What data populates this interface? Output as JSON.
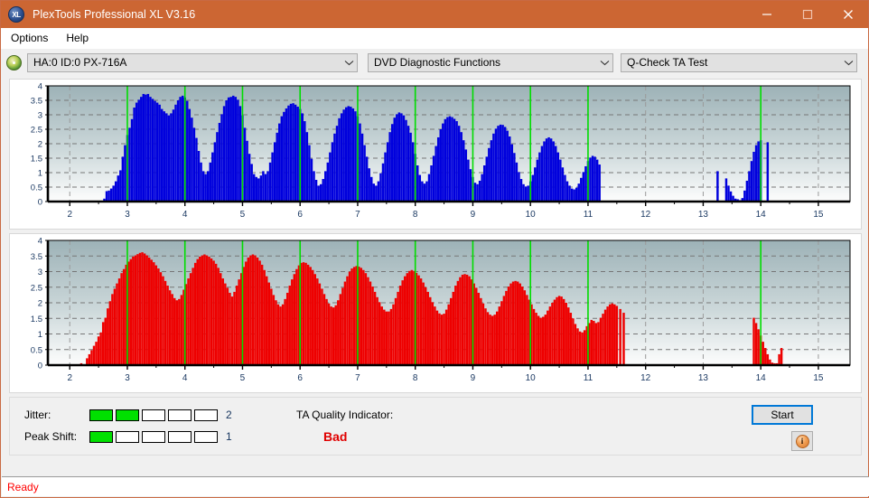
{
  "window": {
    "title": "PlexTools Professional XL V3.16",
    "app_icon": "XL",
    "minimize_label": "Minimize",
    "maximize_label": "Maximize",
    "close_label": "Close"
  },
  "menu": {
    "items": [
      {
        "label": "Options"
      },
      {
        "label": "Help"
      }
    ]
  },
  "toolbar": {
    "drive_icon": "disc-icon",
    "drive_select": "HA:0 ID:0  PX-716A",
    "function_select": "DVD Diagnostic Functions",
    "test_select": "Q-Check TA Test"
  },
  "indicators": {
    "jitter_label": "Jitter:",
    "jitter_value": "2",
    "jitter_filled": 2,
    "jitter_total": 5,
    "peak_shift_label": "Peak Shift:",
    "peak_shift_value": "1",
    "peak_shift_filled": 1,
    "peak_shift_total": 5,
    "meter_on_color": "#00e000",
    "ta_label": "TA Quality Indicator:",
    "ta_value": "Bad",
    "ta_color": "#e00000"
  },
  "actions": {
    "start_label": "Start",
    "info_label": "i",
    "info_icon": "info-icon"
  },
  "status": {
    "text": "Ready",
    "color": "#ff0000"
  },
  "chart_data": [
    {
      "type": "bar",
      "name": "jitter-chart",
      "title": "",
      "xlabel": "",
      "ylabel": "",
      "color": "#0000dd",
      "xlim": [
        1.62,
        15.55
      ],
      "ylim": [
        0,
        4
      ],
      "yticks": [
        0,
        0.5,
        1,
        1.5,
        2,
        2.5,
        3,
        3.5,
        4
      ],
      "ytick_labels": [
        "0",
        "0.5",
        "1",
        "1.5",
        "2",
        "2.5",
        "3",
        "3.5",
        "4"
      ],
      "xticks": [
        2,
        3,
        4,
        5,
        6,
        7,
        8,
        9,
        10,
        11,
        12,
        13,
        14,
        15
      ],
      "xtick_labels": [
        "2",
        "3",
        "4",
        "5",
        "6",
        "7",
        "8",
        "9",
        "10",
        "11",
        "12",
        "13",
        "14",
        "15"
      ],
      "grid": true,
      "marker_color": "#00dd00",
      "markers": [
        3,
        4,
        5,
        6,
        7,
        8,
        9,
        10,
        11,
        14
      ],
      "bar_width": 0.0385,
      "x": [
        2.6,
        2.64,
        2.68,
        2.72,
        2.76,
        2.8,
        2.84,
        2.88,
        2.92,
        2.96,
        3.0,
        3.04,
        3.08,
        3.12,
        3.16,
        3.2,
        3.24,
        3.28,
        3.32,
        3.36,
        3.4,
        3.44,
        3.48,
        3.52,
        3.56,
        3.6,
        3.64,
        3.68,
        3.72,
        3.76,
        3.8,
        3.84,
        3.88,
        3.92,
        3.96,
        4.0,
        4.04,
        4.08,
        4.12,
        4.16,
        4.2,
        4.24,
        4.28,
        4.32,
        4.36,
        4.4,
        4.44,
        4.48,
        4.52,
        4.56,
        4.6,
        4.64,
        4.68,
        4.72,
        4.76,
        4.8,
        4.84,
        4.88,
        4.92,
        4.96,
        5.0,
        5.04,
        5.08,
        5.12,
        5.16,
        5.2,
        5.24,
        5.28,
        5.32,
        5.36,
        5.4,
        5.44,
        5.48,
        5.52,
        5.56,
        5.6,
        5.64,
        5.68,
        5.72,
        5.76,
        5.8,
        5.84,
        5.88,
        5.92,
        5.96,
        6.0,
        6.04,
        6.08,
        6.12,
        6.16,
        6.2,
        6.24,
        6.28,
        6.32,
        6.36,
        6.4,
        6.44,
        6.48,
        6.52,
        6.56,
        6.6,
        6.64,
        6.68,
        6.72,
        6.76,
        6.8,
        6.84,
        6.88,
        6.92,
        6.96,
        7.0,
        7.04,
        7.08,
        7.12,
        7.16,
        7.2,
        7.24,
        7.28,
        7.32,
        7.36,
        7.4,
        7.44,
        7.48,
        7.52,
        7.56,
        7.6,
        7.64,
        7.68,
        7.72,
        7.76,
        7.8,
        7.84,
        7.88,
        7.92,
        7.96,
        8.0,
        8.04,
        8.08,
        8.12,
        8.16,
        8.2,
        8.24,
        8.28,
        8.32,
        8.36,
        8.4,
        8.44,
        8.48,
        8.52,
        8.56,
        8.6,
        8.64,
        8.68,
        8.72,
        8.76,
        8.8,
        8.84,
        8.88,
        8.92,
        8.96,
        9.0,
        9.04,
        9.08,
        9.12,
        9.16,
        9.2,
        9.24,
        9.28,
        9.32,
        9.36,
        9.4,
        9.44,
        9.48,
        9.52,
        9.56,
        9.6,
        9.64,
        9.68,
        9.72,
        9.76,
        9.8,
        9.84,
        9.88,
        9.92,
        9.96,
        10.0,
        10.04,
        10.08,
        10.12,
        10.16,
        10.2,
        10.24,
        10.28,
        10.32,
        10.36,
        10.4,
        10.44,
        10.48,
        10.52,
        10.56,
        10.6,
        10.64,
        10.68,
        10.72,
        10.76,
        10.8,
        10.84,
        10.88,
        10.92,
        10.96,
        11.0,
        11.04,
        11.08,
        11.12,
        11.16,
        11.2,
        13.25,
        13.4,
        13.44,
        13.48,
        13.52,
        13.56,
        13.6,
        13.64,
        13.68,
        13.72,
        13.76,
        13.8,
        13.84,
        13.88,
        13.92,
        13.96,
        14.0,
        14.12
      ],
      "values": [
        0.1,
        0.36,
        0.38,
        0.45,
        0.55,
        0.7,
        0.9,
        1.08,
        1.55,
        1.95,
        2.3,
        2.55,
        2.85,
        3.25,
        3.42,
        3.52,
        3.62,
        3.72,
        3.7,
        3.72,
        3.62,
        3.55,
        3.48,
        3.42,
        3.35,
        3.2,
        3.12,
        3.05,
        2.98,
        3.05,
        3.18,
        3.35,
        3.5,
        3.62,
        3.66,
        3.6,
        3.48,
        3.2,
        2.9,
        2.55,
        2.2,
        1.75,
        1.35,
        1.05,
        0.95,
        1.05,
        1.35,
        1.7,
        2.05,
        2.4,
        2.72,
        3.02,
        3.3,
        3.5,
        3.6,
        3.62,
        3.66,
        3.62,
        3.52,
        3.3,
        2.98,
        2.55,
        2.1,
        1.65,
        1.3,
        0.95,
        0.85,
        0.8,
        0.9,
        1.05,
        0.95,
        1.05,
        1.35,
        1.7,
        2.05,
        2.38,
        2.7,
        2.95,
        3.1,
        3.22,
        3.32,
        3.38,
        3.4,
        3.35,
        3.28,
        3.2,
        3.05,
        2.78,
        2.4,
        1.95,
        1.48,
        1.05,
        0.75,
        0.55,
        0.6,
        0.78,
        1.05,
        1.35,
        1.7,
        2.05,
        2.35,
        2.62,
        2.88,
        3.05,
        3.18,
        3.26,
        3.3,
        3.28,
        3.22,
        3.12,
        2.95,
        2.7,
        2.35,
        1.95,
        1.55,
        1.15,
        0.85,
        0.62,
        0.55,
        0.7,
        0.98,
        1.32,
        1.7,
        2.05,
        2.4,
        2.68,
        2.9,
        3.02,
        3.08,
        3.05,
        2.98,
        2.82,
        2.62,
        2.38,
        2.05,
        1.65,
        1.25,
        0.92,
        0.7,
        0.62,
        0.7,
        0.95,
        1.25,
        1.58,
        1.92,
        2.22,
        2.5,
        2.7,
        2.85,
        2.92,
        2.95,
        2.92,
        2.86,
        2.78,
        2.62,
        2.4,
        2.12,
        1.8,
        1.45,
        1.12,
        0.85,
        0.65,
        0.6,
        0.72,
        0.95,
        1.25,
        1.55,
        1.85,
        2.12,
        2.35,
        2.52,
        2.62,
        2.66,
        2.65,
        2.58,
        2.45,
        2.25,
        1.98,
        1.68,
        1.35,
        1.02,
        0.78,
        0.6,
        0.52,
        0.55,
        0.7,
        0.92,
        1.18,
        1.45,
        1.7,
        1.92,
        2.08,
        2.18,
        2.22,
        2.18,
        2.08,
        1.92,
        1.7,
        1.45,
        1.18,
        0.92,
        0.7,
        0.55,
        0.45,
        0.42,
        0.48,
        0.62,
        0.82,
        1.02,
        1.22,
        1.4,
        1.52,
        1.58,
        1.55,
        1.45,
        1.28,
        1.05,
        0.8,
        0.55,
        0.35,
        0.2,
        0.1,
        0.08,
        0.05,
        0.12,
        0.38,
        0.72,
        1.05,
        1.4,
        1.72,
        1.95,
        2.08,
        2.12,
        2.05,
        1.95,
        1.82,
        1.62,
        1.3,
        0.85,
        0.12
      ]
    },
    {
      "type": "bar",
      "name": "peak-shift-chart",
      "title": "",
      "xlabel": "",
      "ylabel": "",
      "color": "#ee0000",
      "xlim": [
        1.62,
        15.55
      ],
      "ylim": [
        0,
        4
      ],
      "yticks": [
        0,
        0.5,
        1,
        1.5,
        2,
        2.5,
        3,
        3.5,
        4
      ],
      "ytick_labels": [
        "0",
        "0.5",
        "1",
        "1.5",
        "2",
        "2.5",
        "3",
        "3.5",
        "4"
      ],
      "xticks": [
        2,
        3,
        4,
        5,
        6,
        7,
        8,
        9,
        10,
        11,
        12,
        13,
        14,
        15
      ],
      "xtick_labels": [
        "2",
        "3",
        "4",
        "5",
        "6",
        "7",
        "8",
        "9",
        "10",
        "11",
        "12",
        "13",
        "14",
        "15"
      ],
      "grid": true,
      "marker_color": "#00dd00",
      "markers": [
        3,
        4,
        5,
        6,
        7,
        8,
        9,
        10,
        11,
        14
      ],
      "bar_width": 0.0385,
      "x": [
        2.2,
        2.3,
        2.34,
        2.38,
        2.42,
        2.46,
        2.5,
        2.54,
        2.58,
        2.62,
        2.66,
        2.7,
        2.74,
        2.78,
        2.82,
        2.86,
        2.9,
        2.94,
        2.98,
        3.02,
        3.06,
        3.1,
        3.14,
        3.18,
        3.22,
        3.26,
        3.3,
        3.34,
        3.38,
        3.42,
        3.46,
        3.5,
        3.54,
        3.58,
        3.62,
        3.66,
        3.7,
        3.74,
        3.78,
        3.82,
        3.86,
        3.9,
        3.94,
        3.98,
        4.02,
        4.06,
        4.1,
        4.14,
        4.18,
        4.22,
        4.26,
        4.3,
        4.34,
        4.38,
        4.42,
        4.46,
        4.5,
        4.54,
        4.58,
        4.62,
        4.66,
        4.7,
        4.74,
        4.78,
        4.82,
        4.86,
        4.9,
        4.94,
        4.98,
        5.02,
        5.06,
        5.1,
        5.14,
        5.18,
        5.22,
        5.26,
        5.3,
        5.34,
        5.38,
        5.42,
        5.46,
        5.5,
        5.54,
        5.58,
        5.62,
        5.66,
        5.7,
        5.74,
        5.78,
        5.82,
        5.86,
        5.9,
        5.94,
        5.98,
        6.02,
        6.06,
        6.1,
        6.14,
        6.18,
        6.22,
        6.26,
        6.3,
        6.34,
        6.38,
        6.42,
        6.46,
        6.5,
        6.54,
        6.58,
        6.62,
        6.66,
        6.7,
        6.74,
        6.78,
        6.82,
        6.86,
        6.9,
        6.94,
        6.98,
        7.02,
        7.06,
        7.1,
        7.14,
        7.18,
        7.22,
        7.26,
        7.3,
        7.34,
        7.38,
        7.42,
        7.46,
        7.5,
        7.54,
        7.58,
        7.62,
        7.66,
        7.7,
        7.74,
        7.78,
        7.82,
        7.86,
        7.9,
        7.94,
        7.98,
        8.02,
        8.06,
        8.1,
        8.14,
        8.18,
        8.22,
        8.26,
        8.3,
        8.34,
        8.38,
        8.42,
        8.46,
        8.5,
        8.54,
        8.58,
        8.62,
        8.66,
        8.7,
        8.74,
        8.78,
        8.82,
        8.86,
        8.9,
        8.94,
        8.98,
        9.02,
        9.06,
        9.1,
        9.14,
        9.18,
        9.22,
        9.26,
        9.3,
        9.34,
        9.38,
        9.42,
        9.46,
        9.5,
        9.54,
        9.58,
        9.62,
        9.66,
        9.7,
        9.74,
        9.78,
        9.82,
        9.86,
        9.9,
        9.94,
        9.98,
        10.02,
        10.06,
        10.1,
        10.14,
        10.18,
        10.22,
        10.26,
        10.3,
        10.34,
        10.38,
        10.42,
        10.46,
        10.5,
        10.54,
        10.58,
        10.62,
        10.66,
        10.7,
        10.74,
        10.78,
        10.82,
        10.86,
        10.9,
        10.94,
        10.98,
        11.02,
        11.06,
        11.1,
        11.14,
        11.18,
        11.22,
        11.26,
        11.3,
        11.34,
        11.38,
        11.42,
        11.46,
        11.5,
        11.56,
        11.62,
        13.88,
        13.92,
        13.96,
        14.0,
        14.04,
        14.08,
        14.12,
        14.16,
        14.2,
        14.24,
        14.28,
        14.32,
        14.36
      ],
      "values": [
        0.06,
        0.22,
        0.35,
        0.48,
        0.62,
        0.75,
        0.92,
        1.05,
        1.38,
        1.52,
        1.82,
        2.05,
        2.28,
        2.45,
        2.62,
        2.78,
        2.95,
        3.08,
        3.22,
        3.32,
        3.4,
        3.48,
        3.52,
        3.56,
        3.6,
        3.62,
        3.58,
        3.52,
        3.45,
        3.38,
        3.3,
        3.2,
        3.1,
        2.98,
        2.85,
        2.7,
        2.55,
        2.4,
        2.28,
        2.15,
        2.08,
        2.12,
        2.25,
        2.42,
        2.6,
        2.78,
        2.95,
        3.12,
        3.28,
        3.4,
        3.48,
        3.52,
        3.55,
        3.52,
        3.48,
        3.42,
        3.35,
        3.25,
        3.12,
        2.95,
        2.78,
        2.62,
        2.48,
        2.32,
        2.2,
        2.35,
        2.55,
        2.75,
        2.95,
        3.15,
        3.32,
        3.45,
        3.52,
        3.55,
        3.52,
        3.45,
        3.35,
        3.22,
        3.05,
        2.85,
        2.65,
        2.45,
        2.25,
        2.08,
        1.95,
        1.88,
        1.95,
        2.12,
        2.32,
        2.55,
        2.75,
        2.92,
        3.08,
        3.2,
        3.28,
        3.3,
        3.28,
        3.22,
        3.15,
        3.05,
        2.92,
        2.78,
        2.62,
        2.45,
        2.28,
        2.12,
        1.98,
        1.88,
        1.85,
        1.92,
        2.08,
        2.28,
        2.48,
        2.68,
        2.85,
        3.0,
        3.1,
        3.15,
        3.18,
        3.16,
        3.12,
        3.05,
        2.95,
        2.82,
        2.68,
        2.52,
        2.35,
        2.18,
        2.02,
        1.88,
        1.78,
        1.72,
        1.72,
        1.8,
        1.95,
        2.15,
        2.35,
        2.55,
        2.72,
        2.85,
        2.95,
        3.02,
        3.05,
        3.02,
        2.96,
        2.88,
        2.78,
        2.65,
        2.5,
        2.35,
        2.18,
        2.02,
        1.88,
        1.75,
        1.66,
        1.62,
        1.65,
        1.78,
        1.95,
        2.15,
        2.35,
        2.55,
        2.7,
        2.82,
        2.9,
        2.92,
        2.9,
        2.85,
        2.75,
        2.62,
        2.48,
        2.32,
        2.15,
        1.98,
        1.82,
        1.7,
        1.62,
        1.58,
        1.62,
        1.72,
        1.88,
        2.05,
        2.22,
        2.38,
        2.52,
        2.62,
        2.68,
        2.7,
        2.68,
        2.62,
        2.52,
        2.4,
        2.25,
        2.1,
        1.95,
        1.8,
        1.68,
        1.58,
        1.52,
        1.55,
        1.62,
        1.75,
        1.88,
        2.0,
        2.1,
        2.18,
        2.22,
        2.2,
        2.12,
        2.0,
        1.85,
        1.68,
        1.5,
        1.32,
        1.18,
        1.08,
        1.05,
        1.12,
        1.25,
        1.35,
        1.45,
        1.42,
        1.35,
        1.38,
        1.52,
        1.65,
        1.78,
        1.88,
        1.95,
        1.98,
        1.95,
        1.9,
        1.8,
        1.68,
        1.52,
        1.35,
        1.15,
        0.95,
        0.75,
        0.55,
        0.35,
        0.18,
        0.08,
        0.06,
        0.06,
        0.35,
        0.55,
        0.95,
        1.05,
        0.6,
        0.72,
        1.22,
        0.85,
        1.08,
        1.15,
        0.7,
        0.45,
        0.22
      ]
    }
  ]
}
